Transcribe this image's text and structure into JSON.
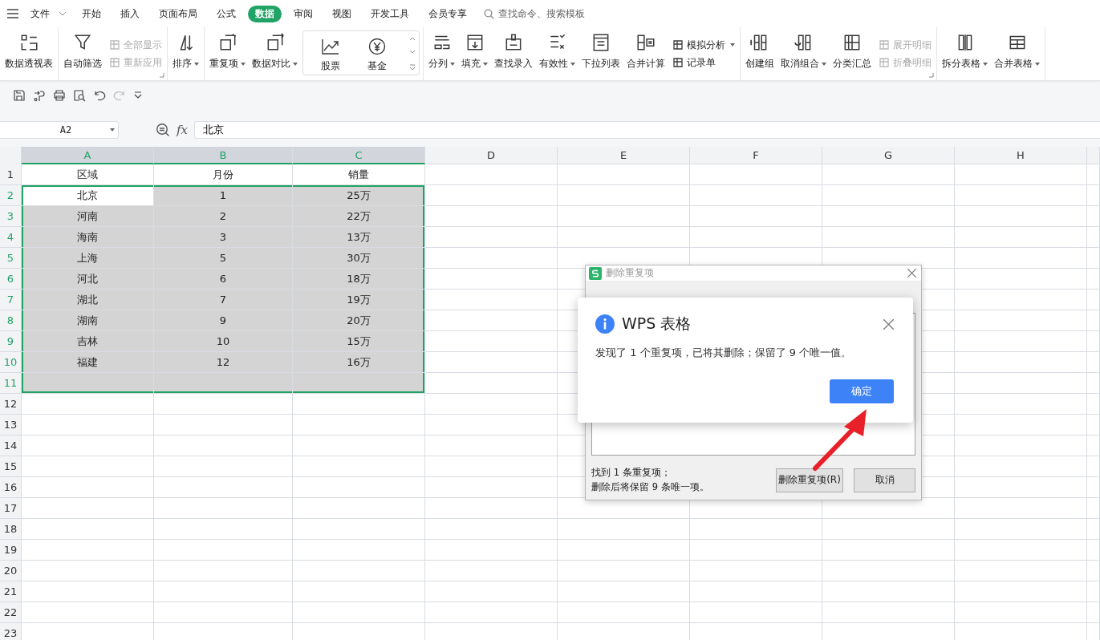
{
  "menu": {
    "file_label": "文件",
    "tabs": [
      {
        "label": "开始",
        "selected": false
      },
      {
        "label": "插入",
        "selected": false
      },
      {
        "label": "页面布局",
        "selected": false
      },
      {
        "label": "公式",
        "selected": false
      },
      {
        "label": "数据",
        "selected": true
      },
      {
        "label": "审阅",
        "selected": false
      },
      {
        "label": "视图",
        "selected": false
      },
      {
        "label": "开发工具",
        "selected": false
      },
      {
        "label": "会员专享",
        "selected": false
      }
    ],
    "search": {
      "placeholder": "查找命令、搜索模板"
    }
  },
  "ribbon": {
    "groups": [
      {
        "tools": [
          {
            "kind": "large",
            "label": "数据透视表",
            "dropdown": false
          }
        ]
      },
      {
        "launcher": true,
        "tools": [
          {
            "kind": "large",
            "label": "自动筛选",
            "dropdown": false
          },
          {
            "kind": "stack",
            "items": [
              {
                "label": "全部显示",
                "disabled": true,
                "dropdown": false
              },
              {
                "label": "重新应用",
                "disabled": true,
                "dropdown": false
              }
            ]
          }
        ]
      },
      {
        "tools": [
          {
            "kind": "large",
            "label": "排序",
            "dropdown": true
          }
        ]
      },
      {
        "tools": [
          {
            "kind": "large",
            "label": "重复项",
            "dropdown": true
          },
          {
            "kind": "large",
            "label": "数据对比",
            "dropdown": true
          },
          {
            "kind": "gallery",
            "items": [
              {
                "label": "股票"
              },
              {
                "label": "基金"
              }
            ]
          }
        ]
      },
      {
        "tools": [
          {
            "kind": "large",
            "label": "分列",
            "dropdown": true
          },
          {
            "kind": "large",
            "label": "填充",
            "dropdown": true
          },
          {
            "kind": "large",
            "label": "查找录入",
            "dropdown": false
          },
          {
            "kind": "large",
            "label": "有效性",
            "dropdown": true
          },
          {
            "kind": "large",
            "label": "下拉列表",
            "dropdown": false
          },
          {
            "kind": "large",
            "label": "合并计算",
            "dropdown": false
          },
          {
            "kind": "stack",
            "items": [
              {
                "label": "模拟分析",
                "disabled": false,
                "dropdown": true
              },
              {
                "label": "记录单",
                "disabled": false,
                "dropdown": false
              }
            ]
          }
        ]
      },
      {
        "launcher": true,
        "tools": [
          {
            "kind": "large",
            "label": "创建组",
            "dropdown": false
          },
          {
            "kind": "large",
            "label": "取消组合",
            "dropdown": true
          },
          {
            "kind": "large",
            "label": "分类汇总",
            "dropdown": false
          },
          {
            "kind": "stack",
            "items": [
              {
                "label": "展开明细",
                "disabled": true,
                "dropdown": false
              },
              {
                "label": "折叠明细",
                "disabled": true,
                "dropdown": false
              }
            ]
          }
        ]
      },
      {
        "tools": [
          {
            "kind": "large",
            "label": "拆分表格",
            "dropdown": true
          },
          {
            "kind": "large",
            "label": "合并表格",
            "dropdown": true
          }
        ]
      }
    ]
  },
  "formula_bar": {
    "name_box": "A2",
    "function_label": "fx",
    "value": "北京"
  },
  "sheet": {
    "columns": [
      {
        "label": "A",
        "selected": true
      },
      {
        "label": "B",
        "selected": true
      },
      {
        "label": "C",
        "selected": true
      },
      {
        "label": "D",
        "selected": false
      },
      {
        "label": "E",
        "selected": false
      },
      {
        "label": "F",
        "selected": false
      },
      {
        "label": "G",
        "selected": false
      },
      {
        "label": "H",
        "selected": false
      }
    ],
    "rows": [
      {
        "label": "1",
        "selected": false,
        "cells": [
          {
            "text": "区域"
          },
          {
            "text": "月份"
          },
          {
            "text": "销量"
          }
        ]
      },
      {
        "label": "2",
        "selected": true,
        "cells": [
          {
            "text": "北京",
            "active": true
          },
          {
            "text": "1",
            "active": false
          },
          {
            "text": "25万",
            "active": false
          }
        ]
      },
      {
        "label": "3",
        "selected": true,
        "cells": [
          {
            "text": "河南",
            "active": false
          },
          {
            "text": "2",
            "active": false
          },
          {
            "text": "22万",
            "active": false
          }
        ]
      },
      {
        "label": "4",
        "selected": true,
        "cells": [
          {
            "text": "海南",
            "active": false
          },
          {
            "text": "3",
            "active": false
          },
          {
            "text": "13万",
            "active": false
          }
        ]
      },
      {
        "label": "5",
        "selected": true,
        "cells": [
          {
            "text": "上海",
            "active": false
          },
          {
            "text": "5",
            "active": false
          },
          {
            "text": "30万",
            "active": false
          }
        ]
      },
      {
        "label": "6",
        "selected": true,
        "cells": [
          {
            "text": "河北",
            "active": false
          },
          {
            "text": "6",
            "active": false
          },
          {
            "text": "18万",
            "active": false
          }
        ]
      },
      {
        "label": "7",
        "selected": true,
        "cells": [
          {
            "text": "湖北",
            "active": false
          },
          {
            "text": "7",
            "active": false
          },
          {
            "text": "19万",
            "active": false
          }
        ]
      },
      {
        "label": "8",
        "selected": true,
        "cells": [
          {
            "text": "湖南",
            "active": false
          },
          {
            "text": "9",
            "active": false
          },
          {
            "text": "20万",
            "active": false
          }
        ]
      },
      {
        "label": "9",
        "selected": true,
        "cells": [
          {
            "text": "吉林",
            "active": false
          },
          {
            "text": "10",
            "active": false
          },
          {
            "text": "15万",
            "active": false
          }
        ]
      },
      {
        "label": "10",
        "selected": true,
        "cells": [
          {
            "text": "福建",
            "active": false
          },
          {
            "text": "12",
            "active": false
          },
          {
            "text": "16万",
            "active": false
          }
        ]
      },
      {
        "label": "11",
        "selected": true
      },
      {
        "label": "12",
        "selected": false
      },
      {
        "label": "13",
        "selected": false
      },
      {
        "label": "14",
        "selected": false
      },
      {
        "label": "15",
        "selected": false
      },
      {
        "label": "16",
        "selected": false
      },
      {
        "label": "17",
        "selected": false
      },
      {
        "label": "18",
        "selected": false
      },
      {
        "label": "19",
        "selected": false
      },
      {
        "label": "20",
        "selected": false
      },
      {
        "label": "21",
        "selected": false
      },
      {
        "label": "22",
        "selected": false
      },
      {
        "label": "23",
        "selected": false
      }
    ]
  },
  "dedupe_dialog": {
    "title": "删除重复项",
    "summary": [
      "找到 1 条重复项；",
      "删除后将保留 9 条唯一项。"
    ],
    "buttons": [
      "删除重复项(R)",
      "取消"
    ]
  },
  "message_box": {
    "title": "WPS 表格",
    "message": "发现了 1 个重复项，已将其删除；保留了 9 个唯一值。",
    "button": "确定"
  }
}
